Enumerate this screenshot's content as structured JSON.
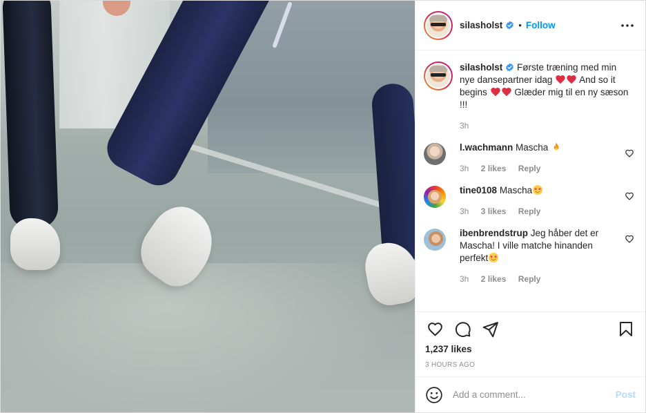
{
  "post": {
    "username": "silasholst",
    "follow_label": "Follow",
    "dot": "•"
  },
  "caption": {
    "username": "silasholst",
    "text_1": "Første træning med min nye dansepartner idag",
    "text_2": "And so it begins",
    "text_3": "Glæder mig til en ny sæson !!!",
    "time": "3h"
  },
  "comments": [
    {
      "username": "l.wachmann",
      "text": "Mascha",
      "emoji": "fire",
      "time": "3h",
      "likes": "2 likes",
      "reply": "Reply"
    },
    {
      "username": "tine0108",
      "text": "Mascha",
      "emoji": "star-struck",
      "time": "3h",
      "likes": "3 likes",
      "reply": "Reply"
    },
    {
      "username": "ibenbrendstrup",
      "text": "Jeg håber det er Mascha! I ville matche hinanden perfekt",
      "emoji": "star-struck",
      "time": "3h",
      "likes": "2 likes",
      "reply": "Reply"
    }
  ],
  "stats": {
    "likes": "1,237 likes",
    "posted": "3 HOURS AGO"
  },
  "composer": {
    "placeholder": "Add a comment...",
    "post_label": "Post"
  },
  "colors": {
    "accent": "#0095f6",
    "post_disabled": "#b3dbff",
    "verified": "#3897f0",
    "heart_red": "#ed4956"
  },
  "icons": [
    "more-options-icon",
    "verified-badge-icon",
    "heart-icon",
    "comment-icon",
    "share-icon",
    "bookmark-icon",
    "emoji-icon"
  ]
}
